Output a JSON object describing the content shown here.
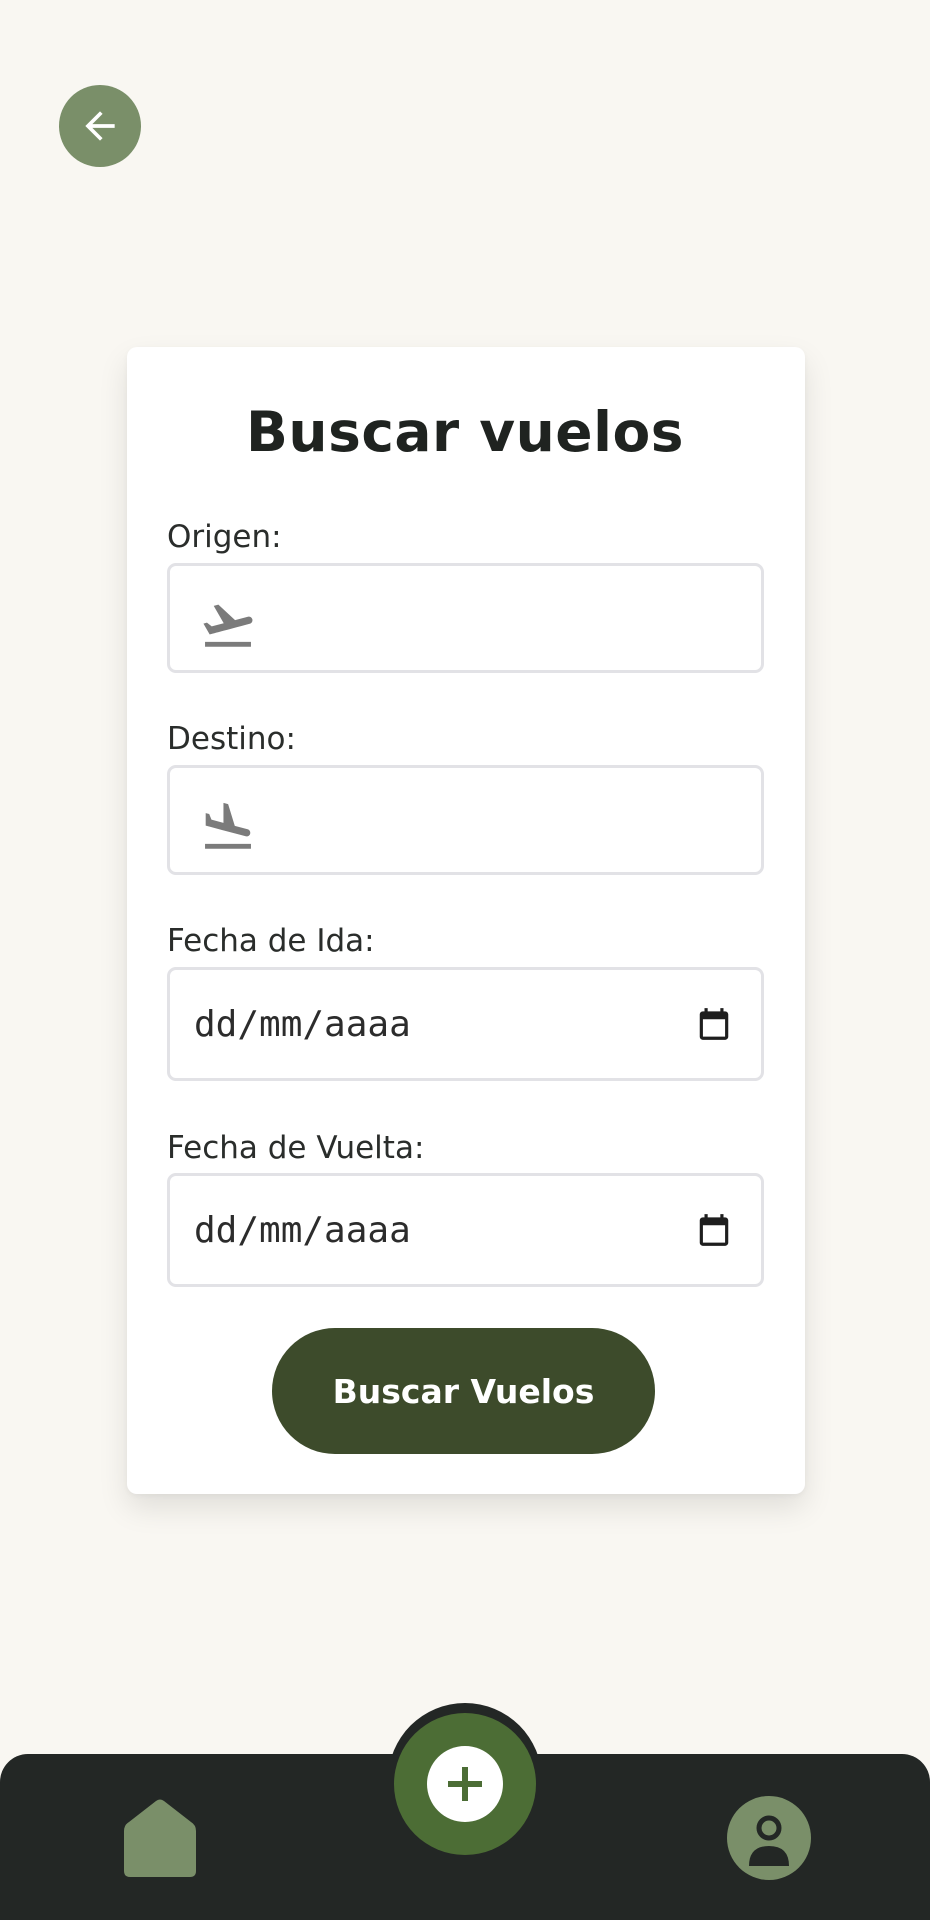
{
  "header": {
    "back_icon": "arrow-left-icon"
  },
  "form": {
    "title": "Buscar vuelos",
    "origin": {
      "label": "Origen:",
      "value": "",
      "icon": "flight-takeoff-icon"
    },
    "destination": {
      "label": "Destino:",
      "value": "",
      "icon": "flight-land-icon"
    },
    "departure_date": {
      "label": "Fecha de Ida:",
      "placeholder": "dd/mm/aaaa",
      "icon": "calendar-icon"
    },
    "return_date": {
      "label": "Fecha de Vuelta:",
      "placeholder": "dd/mm/aaaa",
      "icon": "calendar-icon"
    },
    "submit_label": "Buscar Vuelos"
  },
  "bottom_nav": {
    "items": [
      {
        "icon": "home-icon"
      },
      {
        "icon": "plus-icon"
      },
      {
        "icon": "user-icon"
      }
    ]
  },
  "colors": {
    "background": "#f9f7f2",
    "card": "#ffffff",
    "accent_dark": "#3d4b2b",
    "accent_light": "#7a8f69",
    "fab": "#4c6d35",
    "nav_bar": "#232725"
  }
}
